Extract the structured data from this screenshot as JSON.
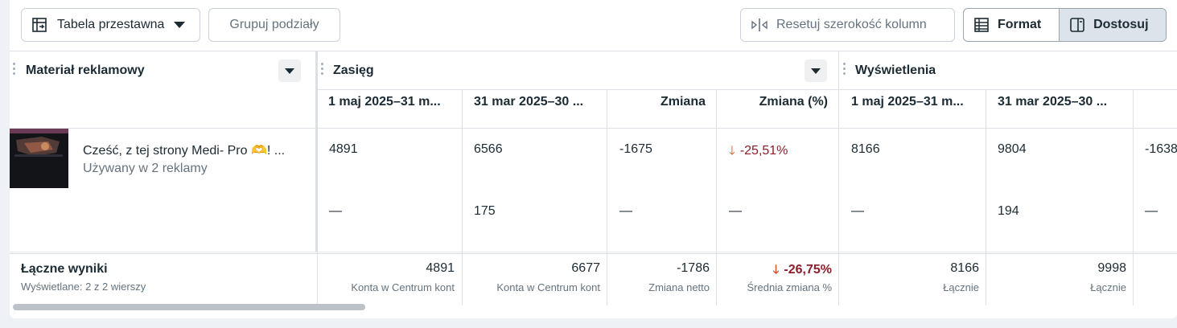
{
  "toolbar": {
    "pivot_label": "Tabela przestawna",
    "group_label": "Grupuj podziały",
    "reset_label": "Resetuj szerokość kolumn",
    "format_label": "Format",
    "customize_label": "Dostosuj"
  },
  "headers": {
    "creative": "Materiał reklamowy",
    "reach": "Zasięg",
    "impressions": "Wyświetlenia",
    "sub": {
      "reach_p1": "1 maj 2025–31 m...",
      "reach_p2": "31 mar 2025–30 ...",
      "reach_change": "Zmiana",
      "reach_change_pct": "Zmiana (%)",
      "impr_p1": "1 maj 2025–31 m...",
      "impr_p2": "31 mar 2025–30 ..."
    }
  },
  "row": {
    "title": "Cześć, z tej strony Medi- Pro 🫶! ...",
    "subtitle": "Używany w 2 reklamy",
    "r1": {
      "reach_p1": "4891",
      "reach_p2": "6566",
      "reach_change": "-1675",
      "reach_change_pct": "-25,51%",
      "impr_p1": "8166",
      "impr_p2": "9804",
      "impr_change": "-1638"
    },
    "r2": {
      "reach_p1": "—",
      "reach_p2": "175",
      "reach_change": "—",
      "reach_change_pct": "—",
      "impr_p1": "—",
      "impr_p2": "194",
      "impr_change": "—"
    }
  },
  "totals": {
    "title": "Łączne wyniki",
    "subtitle": "Wyświetlane: 2 z 2 wierszy",
    "reach_p1": "4891",
    "reach_p1_sub": "Konta w Centrum kont",
    "reach_p2": "6677",
    "reach_p2_sub": "Konta w Centrum kont",
    "reach_change": "-1786",
    "reach_change_sub": "Zmiana netto",
    "reach_change_pct": "-26,75%",
    "reach_change_pct_sub": "Średnia zmiana %",
    "impr_p1": "8166",
    "impr_p1_sub": "Łącznie",
    "impr_p2": "9998",
    "impr_p2_sub": "Łącznie"
  },
  "colors": {
    "negative": "#8c1d2a",
    "down_arrow": "#d94f26",
    "accent_active": "#dde3ea"
  },
  "icons": [
    "pivot-table-icon",
    "caret-down-icon",
    "column-resize-icon",
    "format-table-icon",
    "customize-panel-icon",
    "arrow-down-icon",
    "drag-handle-icon"
  ]
}
